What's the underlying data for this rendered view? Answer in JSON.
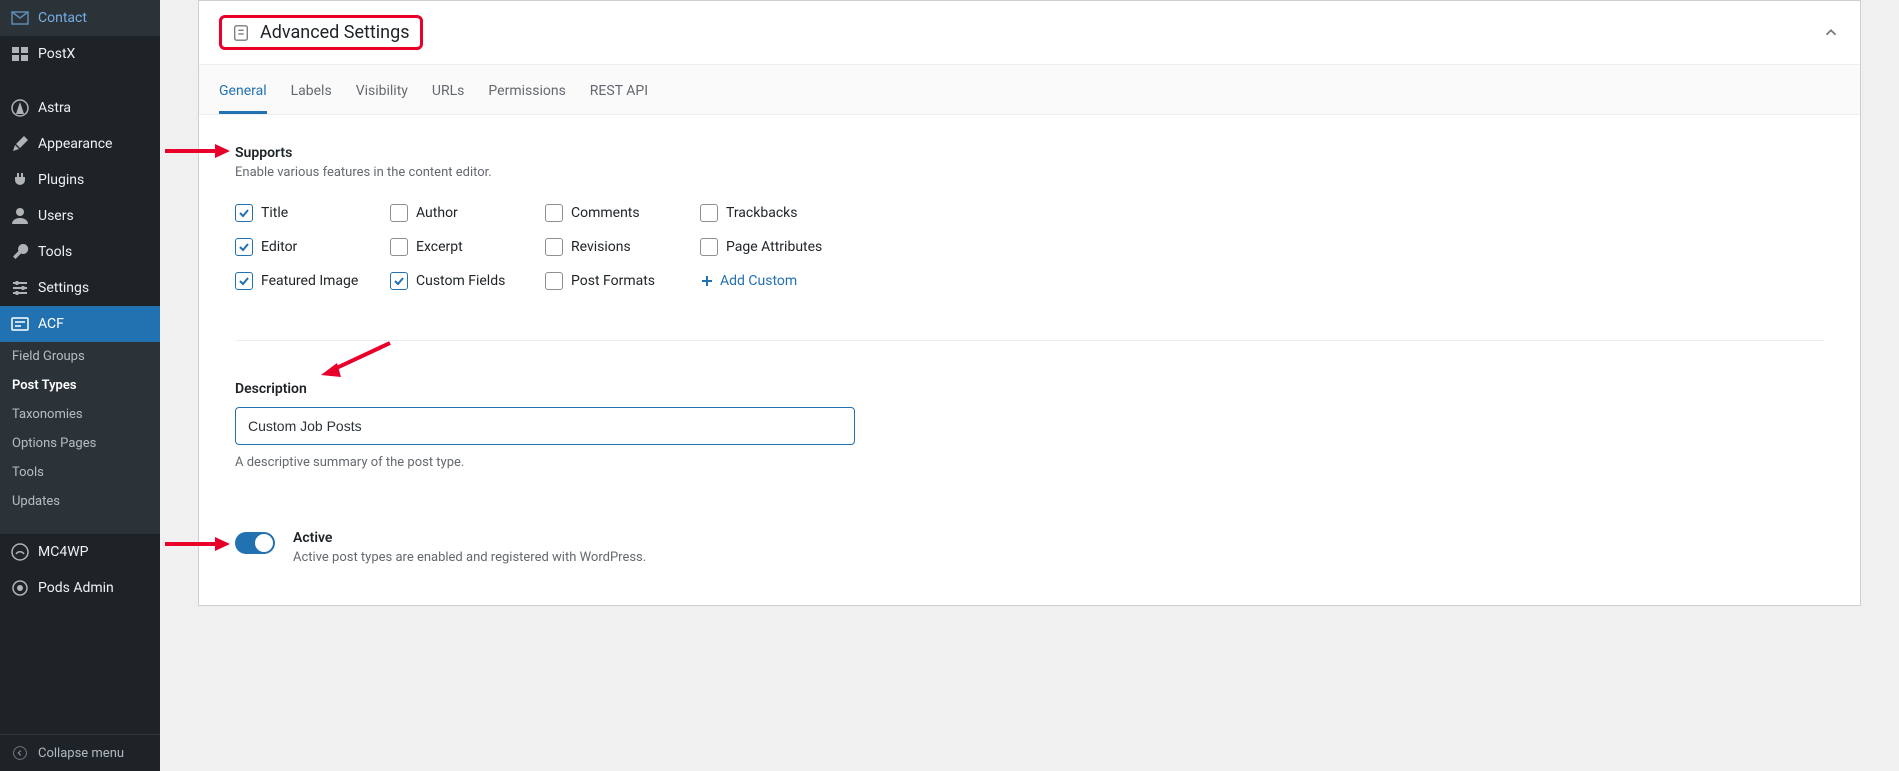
{
  "sidebar": {
    "items": [
      {
        "icon": "mail",
        "label": "Contact"
      },
      {
        "icon": "postx",
        "label": "PostX"
      },
      {
        "icon": "astra",
        "label": "Astra"
      },
      {
        "icon": "brush",
        "label": "Appearance"
      },
      {
        "icon": "plug",
        "label": "Plugins"
      },
      {
        "icon": "user",
        "label": "Users"
      },
      {
        "icon": "wrench",
        "label": "Tools"
      },
      {
        "icon": "sliders",
        "label": "Settings"
      },
      {
        "icon": "acf",
        "label": "ACF"
      }
    ],
    "submenu": [
      {
        "label": "Field Groups"
      },
      {
        "label": "Post Types",
        "current": true
      },
      {
        "label": "Taxonomies"
      },
      {
        "label": "Options Pages"
      },
      {
        "label": "Tools"
      },
      {
        "label": "Updates"
      }
    ],
    "lower": [
      {
        "icon": "mc",
        "label": "MC4WP"
      },
      {
        "icon": "pods",
        "label": "Pods Admin"
      }
    ],
    "collapse": "Collapse menu"
  },
  "panel": {
    "title": "Advanced Settings",
    "tabs": [
      "General",
      "Labels",
      "Visibility",
      "URLs",
      "Permissions",
      "REST API"
    ]
  },
  "supports": {
    "title": "Supports",
    "help": "Enable various features in the content editor.",
    "items": [
      {
        "label": "Title",
        "checked": true
      },
      {
        "label": "Author",
        "checked": false
      },
      {
        "label": "Comments",
        "checked": false
      },
      {
        "label": "Trackbacks",
        "checked": false
      },
      {
        "label": "Editor",
        "checked": true
      },
      {
        "label": "Excerpt",
        "checked": false
      },
      {
        "label": "Revisions",
        "checked": false
      },
      {
        "label": "Page Attributes",
        "checked": false
      },
      {
        "label": "Featured Image",
        "checked": true
      },
      {
        "label": "Custom Fields",
        "checked": true
      },
      {
        "label": "Post Formats",
        "checked": false
      }
    ],
    "add": "Add Custom"
  },
  "description": {
    "label": "Description",
    "value": "Custom Job Posts",
    "hint": "A descriptive summary of the post type."
  },
  "active": {
    "label": "Active",
    "help": "Active post types are enabled and registered with WordPress."
  }
}
